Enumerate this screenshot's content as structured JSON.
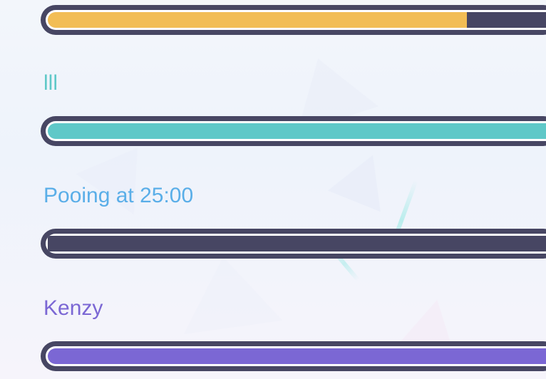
{
  "bars": [
    {
      "label": "",
      "progress": 0.84,
      "color": "#f2bd54"
    },
    {
      "label": "lll",
      "progress": 1.0,
      "color": "#5fc8c8"
    },
    {
      "label": "Pooing at 25:00",
      "progress": 0.0,
      "color": "#5aaee8"
    },
    {
      "label": "Kenzy",
      "progress": 1.0,
      "color": "#7b67d4"
    }
  ],
  "colors": {
    "track": "#474663",
    "border": "#474663",
    "label_lll": "#5fc8c8",
    "label_pooing": "#5aaee8",
    "label_kenzy": "#7b67d4"
  }
}
